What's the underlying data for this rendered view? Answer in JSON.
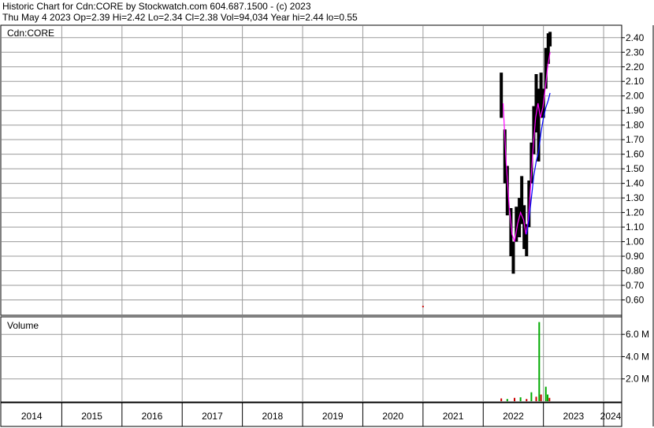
{
  "header": {
    "line1": "Historic Chart for Cdn:CORE by Stockwatch.com 604.687.1500 - (c) 2023",
    "line2": "Thu May  4 2023  Op=2.39  Hi=2.42  Lo=2.34  Cl=2.38  Vol=94,034  Year hi=2.44  lo=0.55"
  },
  "chart_data": {
    "type": "line",
    "title": "Historic Chart for Cdn:CORE by Stockwatch.com 604.687.1500 - (c) 2023",
    "price_panel_label": "Cdn:CORE",
    "volume_panel_label": "Volume",
    "x_axis": {
      "ticks": [
        "2014",
        "2015",
        "2016",
        "2017",
        "2018",
        "2019",
        "2020",
        "2021",
        "2022",
        "2023",
        "2024"
      ]
    },
    "price_axis": {
      "ylim": [
        0.5,
        2.48
      ],
      "ticks": [
        0.6,
        0.7,
        0.8,
        0.9,
        1.0,
        1.1,
        1.2,
        1.3,
        1.4,
        1.5,
        1.6,
        1.7,
        1.8,
        1.9,
        2.0,
        2.1,
        2.2,
        2.3,
        2.4
      ],
      "tick_labels": [
        "0.60",
        "0.70",
        "0.80",
        "0.90",
        "1.00",
        "1.10",
        "1.20",
        "1.30",
        "1.40",
        "1.50",
        "1.60",
        "1.70",
        "1.80",
        "1.90",
        "2.00",
        "2.10",
        "2.20",
        "2.30",
        "2.40"
      ]
    },
    "volume_axis": {
      "ylim": [
        0,
        7.5
      ],
      "ticks": [
        2,
        4,
        6
      ],
      "tick_labels": [
        "2.0 M",
        "4.0 M",
        "6.0 M"
      ]
    },
    "grid": true,
    "colors": {
      "price_bars": "#000000",
      "short_ma": "#ff00ff",
      "long_ma": "#0000ff",
      "volume_up": "#00aa00",
      "volume_down": "#cc0000",
      "grid": "#9a9a9a"
    },
    "series": [
      {
        "kind": "hl_bars",
        "points": [
          {
            "t": 2021.0,
            "h": 0.56,
            "l": 0.55
          },
          {
            "t": 2022.3,
            "h": 2.16,
            "l": 1.85
          },
          {
            "t": 2022.36,
            "h": 1.77,
            "l": 1.4
          },
          {
            "t": 2022.4,
            "h": 1.52,
            "l": 1.18
          },
          {
            "t": 2022.46,
            "h": 1.23,
            "l": 0.9
          },
          {
            "t": 2022.5,
            "h": 1.0,
            "l": 0.78
          },
          {
            "t": 2022.55,
            "h": 1.24,
            "l": 1.0
          },
          {
            "t": 2022.6,
            "h": 1.3,
            "l": 1.03
          },
          {
            "t": 2022.64,
            "h": 1.45,
            "l": 1.12
          },
          {
            "t": 2022.68,
            "h": 1.25,
            "l": 0.95
          },
          {
            "t": 2022.72,
            "h": 1.12,
            "l": 0.9
          },
          {
            "t": 2022.76,
            "h": 1.42,
            "l": 1.1
          },
          {
            "t": 2022.8,
            "h": 1.68,
            "l": 1.4
          },
          {
            "t": 2022.84,
            "h": 1.93,
            "l": 1.6
          },
          {
            "t": 2022.88,
            "h": 2.15,
            "l": 1.75
          },
          {
            "t": 2022.92,
            "h": 2.05,
            "l": 1.55
          },
          {
            "t": 2022.96,
            "h": 2.16,
            "l": 1.85
          },
          {
            "t": 2023.0,
            "h": 2.05,
            "l": 1.85
          },
          {
            "t": 2023.04,
            "h": 2.33,
            "l": 2.05
          },
          {
            "t": 2023.08,
            "h": 2.43,
            "l": 2.22
          },
          {
            "t": 2023.11,
            "h": 2.44,
            "l": 2.34
          }
        ]
      },
      {
        "kind": "line",
        "color_key": "short_ma",
        "points": [
          [
            2022.33,
            1.95
          ],
          [
            2022.38,
            1.55
          ],
          [
            2022.43,
            1.25
          ],
          [
            2022.48,
            1.05
          ],
          [
            2022.52,
            1.0
          ],
          [
            2022.57,
            1.12
          ],
          [
            2022.62,
            1.2
          ],
          [
            2022.67,
            1.15
          ],
          [
            2022.71,
            1.05
          ],
          [
            2022.75,
            1.15
          ],
          [
            2022.79,
            1.4
          ],
          [
            2022.83,
            1.65
          ],
          [
            2022.87,
            1.85
          ],
          [
            2022.91,
            1.95
          ],
          [
            2022.95,
            1.85
          ],
          [
            2022.99,
            1.92
          ],
          [
            2023.03,
            2.05
          ],
          [
            2023.07,
            2.2
          ],
          [
            2023.11,
            2.3
          ]
        ]
      },
      {
        "kind": "line",
        "color_key": "long_ma",
        "points": [
          [
            2022.72,
            1.05
          ],
          [
            2022.76,
            1.15
          ],
          [
            2022.8,
            1.3
          ],
          [
            2022.84,
            1.45
          ],
          [
            2022.88,
            1.55
          ],
          [
            2022.92,
            1.62
          ],
          [
            2022.96,
            1.75
          ],
          [
            2023.0,
            1.85
          ],
          [
            2023.04,
            1.92
          ],
          [
            2023.08,
            1.97
          ],
          [
            2023.11,
            2.02
          ]
        ]
      },
      {
        "kind": "volume_bars",
        "points": [
          {
            "t": 2022.3,
            "v": 0.25,
            "up": false
          },
          {
            "t": 2022.4,
            "v": 0.2,
            "up": true
          },
          {
            "t": 2022.52,
            "v": 0.3,
            "up": false
          },
          {
            "t": 2022.62,
            "v": 0.35,
            "up": true
          },
          {
            "t": 2022.72,
            "v": 0.2,
            "up": false
          },
          {
            "t": 2022.8,
            "v": 0.8,
            "up": true
          },
          {
            "t": 2022.88,
            "v": 0.4,
            "up": false
          },
          {
            "t": 2022.93,
            "v": 7.1,
            "up": true
          },
          {
            "t": 2022.96,
            "v": 0.6,
            "up": false
          },
          {
            "t": 2023.04,
            "v": 1.3,
            "up": true
          },
          {
            "t": 2023.07,
            "v": 0.6,
            "up": true
          },
          {
            "t": 2023.1,
            "v": 0.3,
            "up": false
          }
        ]
      }
    ]
  }
}
